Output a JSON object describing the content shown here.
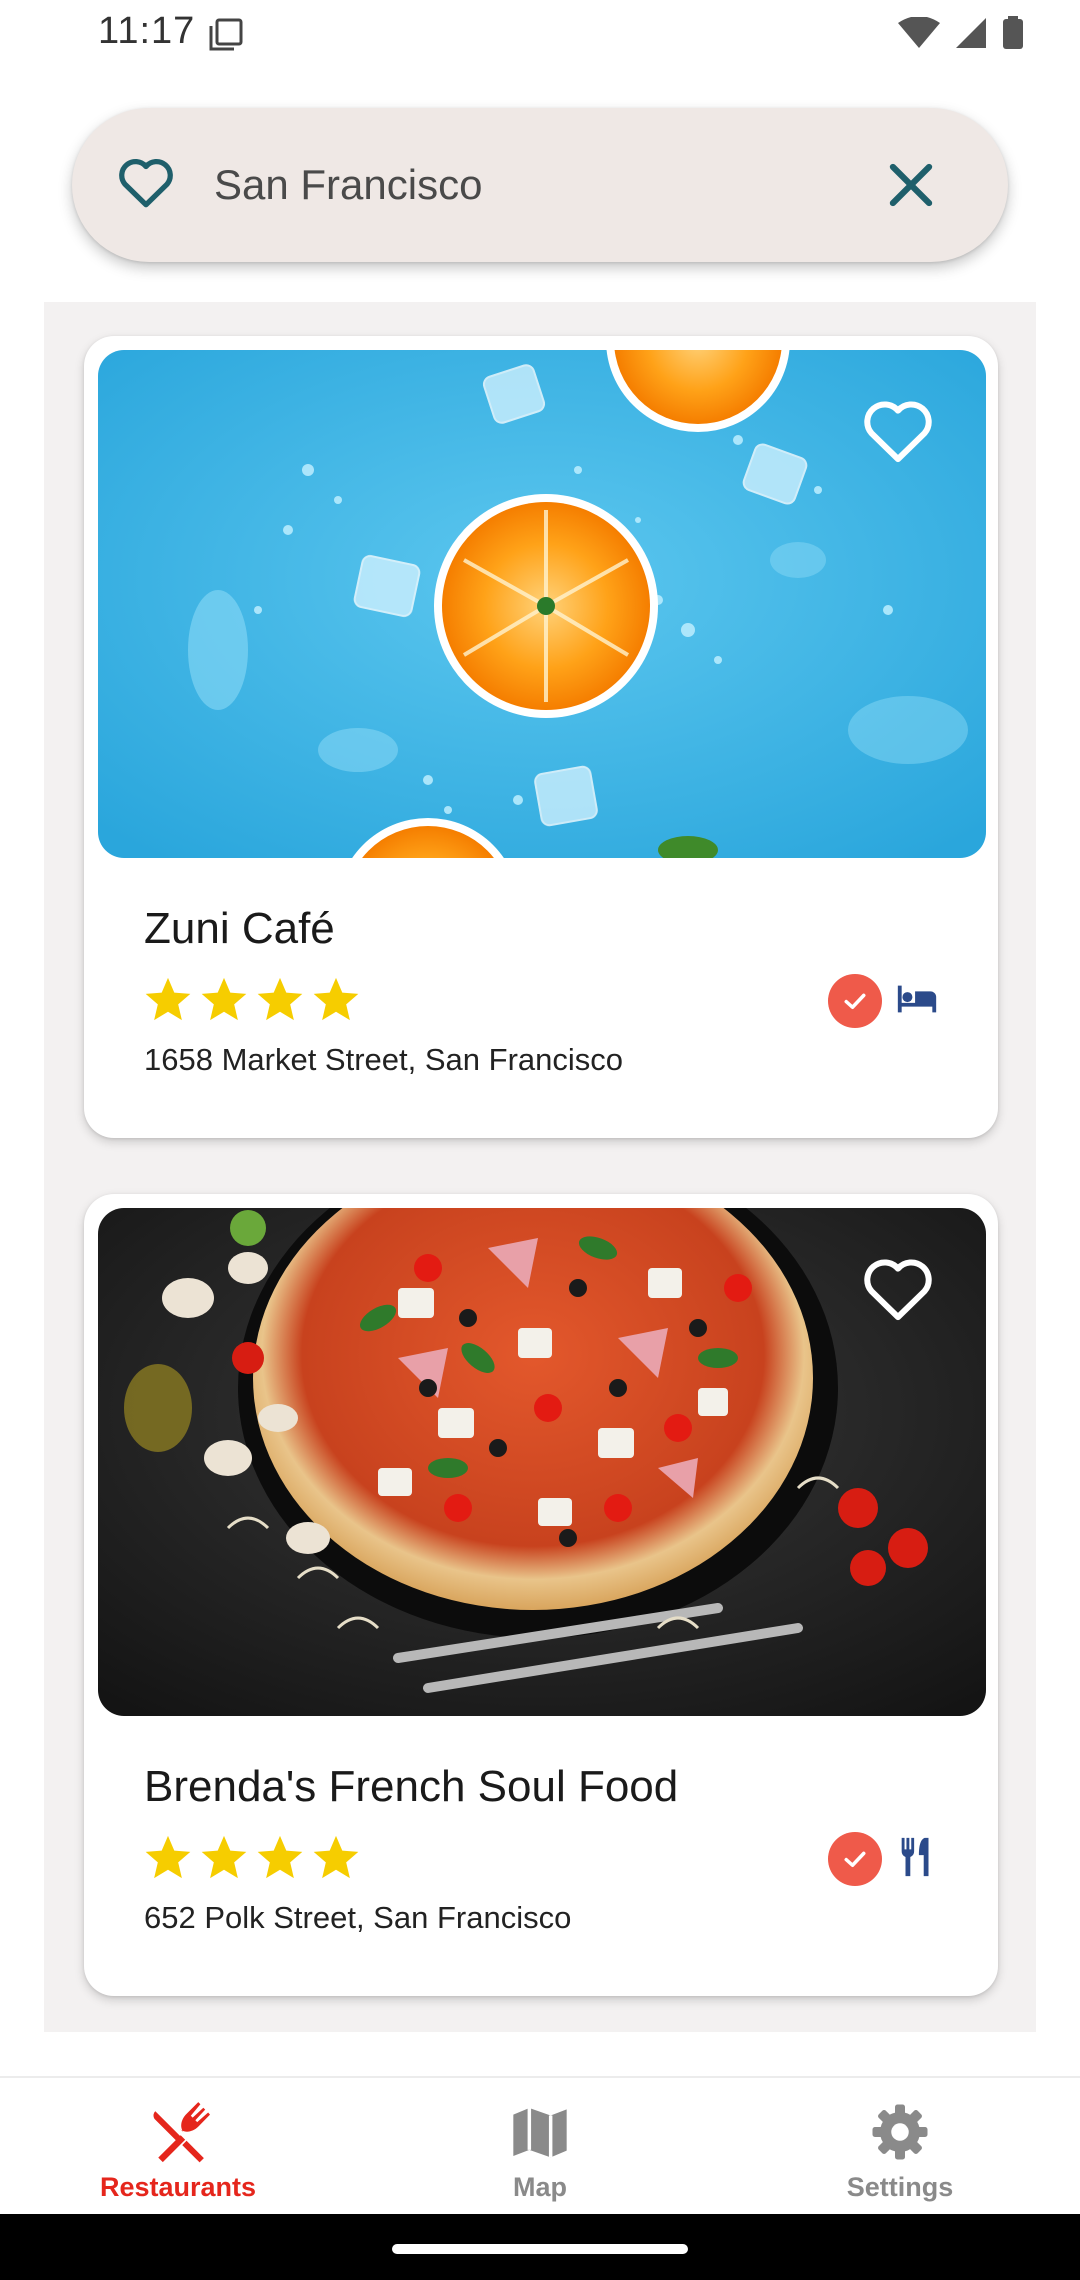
{
  "status_bar": {
    "time": "11:17"
  },
  "search": {
    "value": "San Francisco"
  },
  "restaurants": [
    {
      "name": "Zuni Café",
      "address": "1658 Market Street, San Francisco",
      "rating": 4,
      "checked": true,
      "type_icon": "bed-icon"
    },
    {
      "name": "Brenda's French Soul Food",
      "address": "652 Polk Street, San Francisco",
      "rating": 4,
      "checked": true,
      "type_icon": "fork-knife-icon"
    }
  ],
  "bottom_nav": {
    "items": [
      {
        "label": "Restaurants",
        "icon": "restaurant-icon",
        "active": true
      },
      {
        "label": "Map",
        "icon": "map-icon",
        "active": false
      },
      {
        "label": "Settings",
        "icon": "gear-icon",
        "active": false
      }
    ]
  },
  "colors": {
    "accent": "#e5261c",
    "check": "#ef5a4a",
    "icon_teal": "#1f5f6b",
    "icon_blue": "#2b4a8a",
    "star": "#f6cd00",
    "search_bg": "#efe8e5",
    "nav_inactive": "#8a8a8a"
  }
}
